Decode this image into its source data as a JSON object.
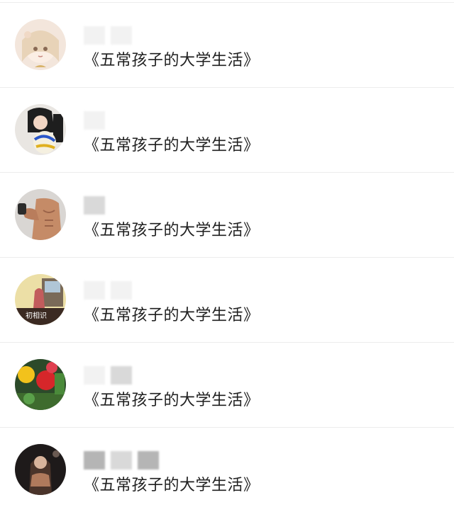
{
  "chat_list": {
    "items": [
      {
        "message": "《五常孩子的大学生活》",
        "avatar": "anime-girl-avatar",
        "avatar_color": "#e8d3c8"
      },
      {
        "message": "《五常孩子的大学生活》",
        "avatar": "volleyball-girl-avatar",
        "avatar_color": "#2a2a2a"
      },
      {
        "message": "《五常孩子的大学生活》",
        "avatar": "bodybuilder-avatar",
        "avatar_color": "#c08a6a"
      },
      {
        "message": "《五常孩子的大学生活》",
        "avatar": "classroom-avatar",
        "avatar_color": "#e9dca0"
      },
      {
        "message": "《五常孩子的大学生活》",
        "avatar": "flowers-avatar",
        "avatar_color": "#d13a3a"
      },
      {
        "message": "《五常孩子的大学生活》",
        "avatar": "dark-portrait-avatar",
        "avatar_color": "#3a2a24"
      }
    ],
    "avatar_4_caption": "初相识"
  }
}
